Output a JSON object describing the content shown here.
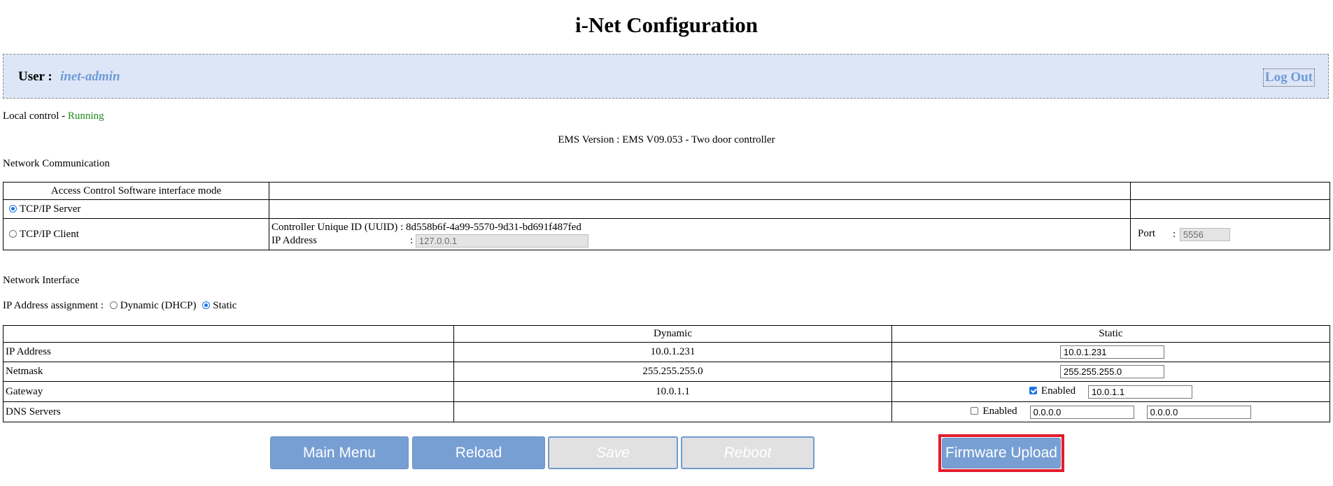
{
  "title": "i-Net Configuration",
  "user": {
    "label": "User :",
    "name": "inet-admin",
    "logout": "Log Out"
  },
  "status": {
    "local_control_label": "Local control -",
    "local_control_value": "Running",
    "ems_version": "EMS Version : EMS V09.053 - Two door controller"
  },
  "network_communication": {
    "section_title": "Network Communication",
    "mode_header": "Access Control Software interface mode",
    "tcp_server_label": "TCP/IP Server",
    "tcp_server_selected": true,
    "tcp_client_label": "TCP/IP Client",
    "tcp_client_selected": false,
    "uuid_label": "Controller Unique ID (UUID) :",
    "uuid_value": "8d558b6f-4a99-5570-9d31-bd691f487fed",
    "ip_label": "IP Address",
    "ip_colon": ":",
    "ip_value": "127.0.0.1",
    "port_label": "Port",
    "port_colon": ":",
    "port_value": "5556"
  },
  "network_interface": {
    "section_title": "Network Interface",
    "assignment_label": "IP Address assignment :",
    "dhcp_label": "Dynamic (DHCP)",
    "dhcp_selected": false,
    "static_label": "Static",
    "static_selected": true,
    "columns": [
      "",
      "Dynamic",
      "Static"
    ],
    "rows": {
      "ip": {
        "label": "IP Address",
        "dynamic": "10.0.1.231",
        "static": "10.0.1.231"
      },
      "netmask": {
        "label": "Netmask",
        "dynamic": "255.255.255.0",
        "static": "255.255.255.0"
      },
      "gateway": {
        "label": "Gateway",
        "dynamic": "10.0.1.1",
        "enabled_label": "Enabled",
        "enabled": true,
        "static": "10.0.1.1"
      },
      "dns": {
        "label": "DNS Servers",
        "dynamic": "",
        "enabled_label": "Enabled",
        "enabled": false,
        "static_primary": "0.0.0.0",
        "static_secondary": "0.0.0.0"
      }
    }
  },
  "buttons": {
    "main_menu": "Main Menu",
    "reload": "Reload",
    "save": "Save",
    "reboot": "Reboot",
    "firmware_upload": "Firmware Upload"
  },
  "colors": {
    "accent": "#779fd4",
    "user_bar": "#dde6f6",
    "running": "#1f8a1f",
    "highlight": "#e31b2e"
  }
}
